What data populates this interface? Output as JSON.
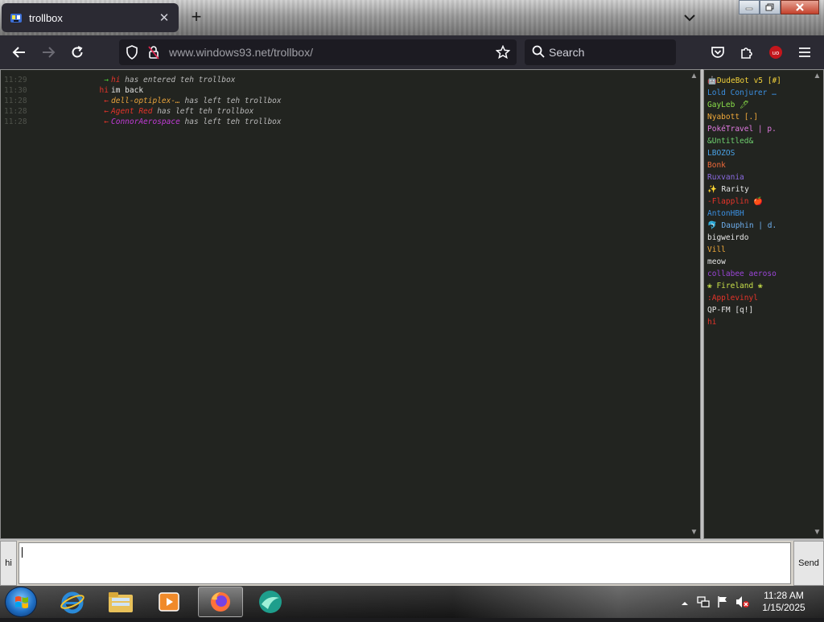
{
  "browser": {
    "tab_title": "trollbox",
    "url_domain": "www.windows93.net",
    "url_path": "/trollbox/",
    "search_placeholder": "Search",
    "extension_badge": "uo"
  },
  "chat": {
    "messages": [
      {
        "time": "11:29",
        "prefix": "→",
        "prefix_color": "#4cd137",
        "nick": "hi",
        "nick_color": "#e6342a",
        "text": " has entered teh trollbox",
        "style": "system"
      },
      {
        "time": "11:30",
        "prefix": "hi",
        "prefix_color": "#e6342a",
        "nick": "",
        "nick_color": "#e6e6e6",
        "text": "im back",
        "style": "plain"
      },
      {
        "time": "11:28",
        "prefix": "←",
        "prefix_color": "#e6342a",
        "nick": "dell-optiplex-…",
        "nick_color": "#e8a33c",
        "text": " has left teh trollbox",
        "style": "system"
      },
      {
        "time": "11:28",
        "prefix": "←",
        "prefix_color": "#e6342a",
        "nick": "Agent Red",
        "nick_color": "#e6342a",
        "text": " has left teh trollbox",
        "style": "system"
      },
      {
        "time": "11:28",
        "prefix": "←",
        "prefix_color": "#e6342a",
        "nick": "ConnorAerospace",
        "nick_color": "#c13bd6",
        "text": " has left teh trollbox",
        "style": "system"
      }
    ]
  },
  "users": [
    {
      "name": "🤖DudeBot v5 [#]",
      "color": "#f3d23b"
    },
    {
      "name": "Lold Conjurer …",
      "color": "#3b8fe0"
    },
    {
      "name": "GayLeb 🖊",
      "color": "#8be04a"
    },
    {
      "name": "Nyabott [.]",
      "color": "#f0a93a"
    },
    {
      "name": "PokéTravel | p.",
      "color": "#e07ae0"
    },
    {
      "name": "&Untitled&",
      "color": "#6fd06f"
    },
    {
      "name": "LBOZOS",
      "color": "#4aa3e8"
    },
    {
      "name": "Bonk",
      "color": "#f06a3a"
    },
    {
      "name": "Ruxvania",
      "color": "#8a6ae0"
    },
    {
      "name": "✨ Rarity",
      "color": "#e6e6e6"
    },
    {
      "name": "-Flapplin 🍎",
      "color": "#e6342a"
    },
    {
      "name": "AntonHBH",
      "color": "#3b8fe0"
    },
    {
      "name": "🐬 Dauphin | d.",
      "color": "#6fb0f0"
    },
    {
      "name": "bigweirdo",
      "color": "#e6e6e6"
    },
    {
      "name": "Vill",
      "color": "#f0a93a"
    },
    {
      "name": "meow",
      "color": "#e6e6e6"
    },
    {
      "name": "collabee aeroso",
      "color": "#9a45d6"
    },
    {
      "name": "❀ Fireland ❀",
      "color": "#c8e04a"
    },
    {
      "name": ":Applevinyl",
      "color": "#e6342a"
    },
    {
      "name": "QP-FM [q!]",
      "color": "#e6e6e6"
    },
    {
      "name": "hi",
      "color": "#e6342a"
    }
  ],
  "input": {
    "nick_label": "hi",
    "value": "",
    "send_label": "Send"
  },
  "taskbar": {
    "time": "11:28 AM",
    "date": "1/15/2025"
  }
}
